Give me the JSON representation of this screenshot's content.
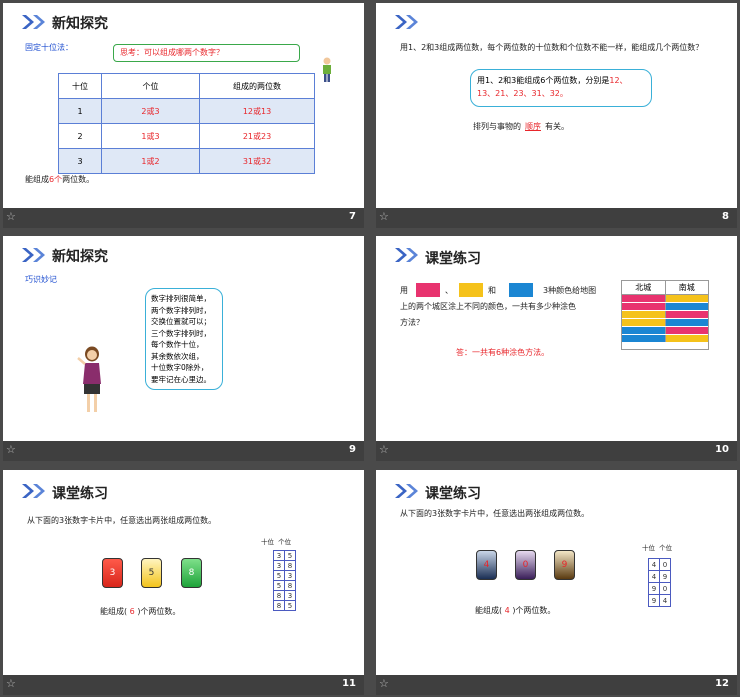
{
  "slides": {
    "s7": {
      "number": "7",
      "title": "新知探究",
      "subtitle": "固定十位法：",
      "bubble": "思考：可以组成哪两个数字？",
      "table": {
        "headers": [
          "十位",
          "个位",
          "组成的两位数"
        ],
        "rows": [
          [
            "1",
            "2或3",
            "12或13"
          ],
          [
            "2",
            "1或3",
            "21或23"
          ],
          [
            "3",
            "1或2",
            "31或32"
          ]
        ]
      },
      "result_prefix": "能组成",
      "result_count": "6个",
      "result_suffix": "两位数。"
    },
    "s8": {
      "number": "8",
      "question": "用1、2和3组成两位数，每个两位数的十位数和个位数不能一样，能组成几个两位数？",
      "answer_prefix": "用1、2和3能组成6个两位数，分别是",
      "answer_values": "12、13、21、23、31、32。",
      "order_prefix": "排列与事物的",
      "order_word": "顺序",
      "order_suffix": "有关。"
    },
    "s9": {
      "number": "9",
      "title": "新知探究",
      "subtitle": "巧识妙记",
      "poem": [
        "数字排列很简单，",
        "两个数字排列时，",
        "交换位置就可以；",
        "三个数字排列时，",
        "每个数作十位，",
        "其余数依次组，",
        "十位数字0除外，",
        "要牢记在心里边。"
      ]
    },
    "s10": {
      "number": "10",
      "title": "课堂练习",
      "q_use": "用",
      "q_sep": "、",
      "q_and": "和",
      "q_rest": "3种颜色给地图",
      "q_line2": "上的两个城区涂上不同的颜色，一共有多少种涂色",
      "q_line3": "方法？",
      "answer": "答：一共有6种涂色方法。",
      "col_north": "北城",
      "col_south": "南城",
      "colors": {
        "pink": "#e8336f",
        "yellow": "#f5c21b",
        "blue": "#1b86d3"
      },
      "pairs": [
        [
          "pink",
          "yellow"
        ],
        [
          "pink",
          "blue"
        ],
        [
          "yellow",
          "pink"
        ],
        [
          "yellow",
          "blue"
        ],
        [
          "blue",
          "pink"
        ],
        [
          "blue",
          "yellow"
        ]
      ]
    },
    "s11": {
      "number": "11",
      "title": "课堂练习",
      "question": "从下面的3张数字卡片中，任意选出两张组成两位数。",
      "cards": [
        "3",
        "5",
        "8"
      ],
      "grid_headers": [
        "十位",
        "个位"
      ],
      "grid": [
        [
          "3",
          "5"
        ],
        [
          "3",
          "8"
        ],
        [
          "5",
          "3"
        ],
        [
          "5",
          "8"
        ],
        [
          "8",
          "3"
        ],
        [
          "8",
          "5"
        ]
      ],
      "result_prefix": "能组成(",
      "result_value": "6",
      "result_suffix": ")个两位数。"
    },
    "s12": {
      "number": "12",
      "title": "课堂练习",
      "question": "从下面的3张数字卡片中，任意选出两张组成两位数。",
      "cards": [
        "4",
        "0",
        "9"
      ],
      "grid_headers": [
        "十位",
        "个位"
      ],
      "grid": [
        [
          "4",
          "0"
        ],
        [
          "4",
          "9"
        ],
        [
          "9",
          "0"
        ],
        [
          "9",
          "4"
        ]
      ],
      "result_prefix": "能组成(",
      "result_value": "4",
      "result_suffix": ")个两位数。"
    }
  }
}
